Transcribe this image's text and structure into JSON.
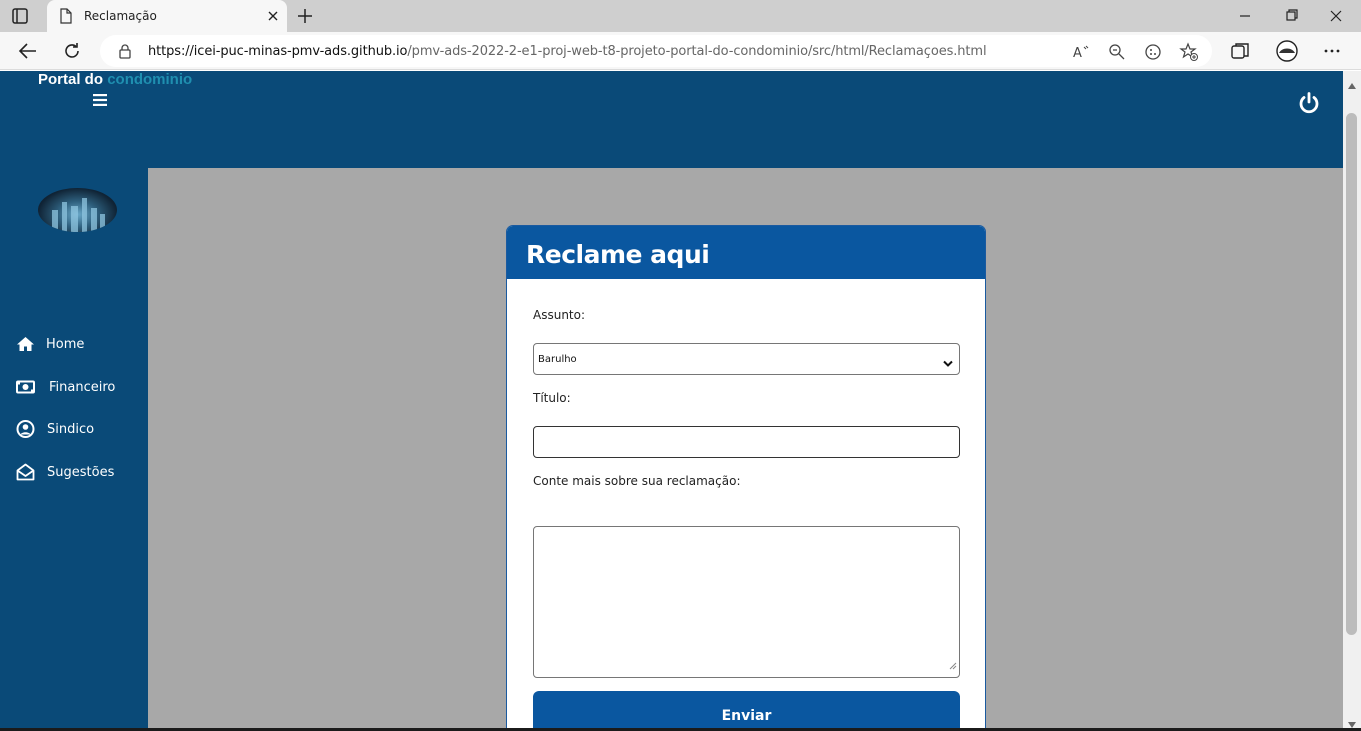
{
  "browser": {
    "tab_title": "Reclamação",
    "url_host": "https://icei-puc-minas-pmv-ads.github.io",
    "url_path": "/pmv-ads-2022-2-e1-proj-web-t8-projeto-portal-do-condominio/src/html/Reclamaçoes.html"
  },
  "header": {
    "brand_prefix": "Portal do",
    "brand_accent": "condominio"
  },
  "sidebar": {
    "items": [
      {
        "label": "Home",
        "icon": "home-icon"
      },
      {
        "label": "Financeiro",
        "icon": "money-icon"
      },
      {
        "label": "Sindico",
        "icon": "user-circle-icon"
      },
      {
        "label": "Sugestões",
        "icon": "envelope-open-icon"
      }
    ]
  },
  "form": {
    "title": "Reclame aqui",
    "subject_label": "Assunto:",
    "subject_value": "Barulho",
    "title_label": "Título:",
    "title_value": "",
    "details_label": "Conte mais sobre sua reclamação:",
    "details_value": "",
    "submit_label": "Enviar"
  },
  "colors": {
    "primary": "#0a4a78",
    "accent": "#1f8fb0",
    "button": "#0a57a0",
    "page_bg": "#a8a8a8"
  }
}
